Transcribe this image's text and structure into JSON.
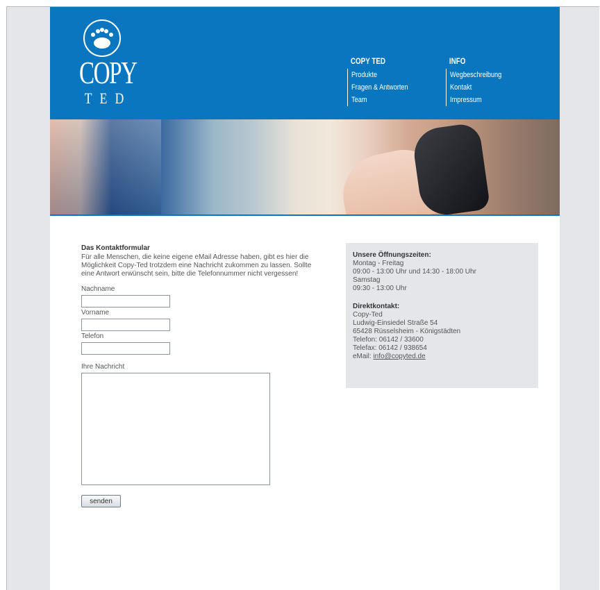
{
  "header": {
    "logo_text": "COPY",
    "logo_sub": "TED",
    "nav": [
      {
        "title": "COPY TED",
        "items": [
          "Produkte",
          "Fragen & Antworten",
          "Team"
        ]
      },
      {
        "title": "INFO",
        "items": [
          "Wegbeschreibung",
          "Kontakt",
          "Impressum"
        ]
      }
    ]
  },
  "form": {
    "title": "Das Kontaktformular",
    "intro": "Für alle Menschen, die keine eigene eMail Adresse haben, gibt es hier die Möglichkeit Copy-Ted trotzdem eine Nachricht zukommen zu lassen. Sollte eine Antwort erwünscht sein, bitte die Telefonnummer nicht vergessen!",
    "label_nachname": "Nachname",
    "label_vorname": "Vorname",
    "label_telefon": "Telefon",
    "label_nachricht": "Ihre Nachricht",
    "value_nachname": "",
    "value_vorname": "",
    "value_telefon": "",
    "value_nachricht": "",
    "send_label": "senden"
  },
  "info": {
    "hours_title": "Unsere Öffnungszeiten:",
    "hours": [
      "Montag - Freitag",
      "09:00 - 13:00 Uhr und 14:30 - 18:00 Uhr",
      "Samstag",
      "09:30 - 13:00 Uhr"
    ],
    "contact_title": "Direktkontakt:",
    "contact": [
      "Copy-Ted",
      "Ludwig-Einsiedel Straße 54",
      "65428 Rüsselsheim - Königstädten",
      "Telefon: 06142 / 33600",
      "Telefax: 06142 / 938654"
    ],
    "email_label": "eMail: ",
    "email": "info@copyted.de"
  },
  "colors": {
    "header_blue": "#0a76c0",
    "page_bg": "#e4e6e9",
    "info_box_bg": "#e4e6e9"
  }
}
